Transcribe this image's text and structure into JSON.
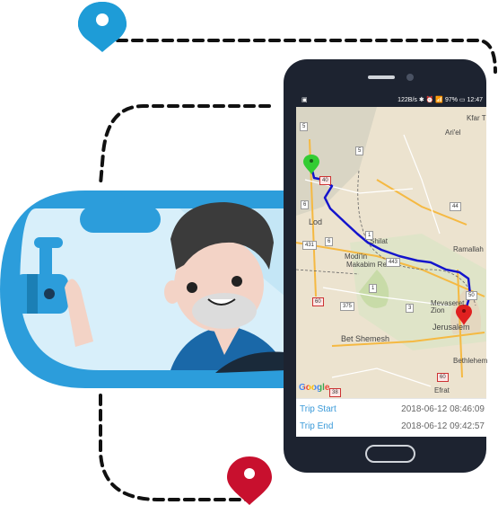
{
  "status_bar": {
    "left_icon": "notification-icon",
    "right_text": "122B/s ✱ ⏰ 📶 97% ▭ 12:47"
  },
  "map": {
    "labels": [
      {
        "id": "arel",
        "text": "Ari'el"
      },
      {
        "id": "kfar",
        "text": "Kfar T"
      },
      {
        "id": "lod",
        "text": "Lod"
      },
      {
        "id": "shilat",
        "text": "Shilat"
      },
      {
        "id": "modiin",
        "text": "Modi'in"
      },
      {
        "id": "makabim",
        "text": "Makabim Re'ut"
      },
      {
        "id": "ramallah",
        "text": "Ramallah"
      },
      {
        "id": "mevaseret",
        "text": "Mevaseret Zion"
      },
      {
        "id": "jerusalem",
        "text": "Jerusalem"
      },
      {
        "id": "betshemesh",
        "text": "Bet Shemesh"
      },
      {
        "id": "bethlehem",
        "text": "Bethlehem"
      },
      {
        "id": "efrat",
        "text": "Efrat"
      }
    ],
    "shields": [
      "5",
      "5",
      "40",
      "6",
      "431",
      "1",
      "443",
      "50",
      "1",
      "375",
      "60",
      "38",
      "60",
      "3",
      "44",
      "6"
    ],
    "colors": {
      "route": "#1414cc",
      "start_pin": "#33cc33",
      "end_pin": "#e02020"
    }
  },
  "google_logo": "Google",
  "trip": {
    "start_label": "Trip Start",
    "start_value": "2018-06-12 08:46:09",
    "end_label": "Trip End",
    "end_value": "2018-06-12 09:42:57"
  },
  "colors": {
    "accent": "#3a9ad9",
    "phone_body": "#1d2330",
    "car_blue": "#2c9ddb",
    "pin_blue": "#1e9cd7",
    "pin_red": "#c8102e"
  }
}
